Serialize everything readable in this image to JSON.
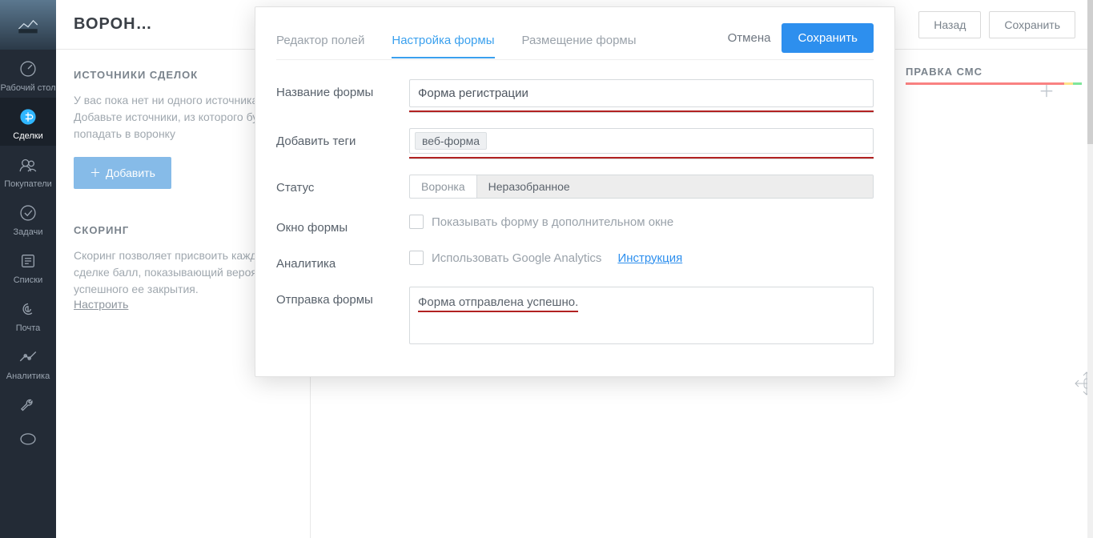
{
  "nav": {
    "items": [
      {
        "label": "Рабочий стол"
      },
      {
        "label": "Сделки"
      },
      {
        "label": "Покупатели"
      },
      {
        "label": "Задачи"
      },
      {
        "label": "Списки"
      },
      {
        "label": "Почта"
      },
      {
        "label": "Аналитика"
      }
    ]
  },
  "header": {
    "title": "ВОРОН…",
    "back": "Назад",
    "save": "Сохранить"
  },
  "sources": {
    "heading": "ИСТОЧНИКИ СДЕЛОК",
    "desc": "У вас пока нет ни одного источника. Добавьте источники, из которого будут попадать в воронку",
    "add": "Добавить"
  },
  "scoring": {
    "heading": "СКОРИНГ",
    "desc": "Скоринг позволяет присвоить каждой сделке балл, показывающий вероятность успешного ее закрытия.",
    "configure": "Настроить"
  },
  "stage": {
    "label": "ПРАВКА СМС"
  },
  "modal": {
    "tabs": {
      "editor": "Редактор полей",
      "settings": "Настройка формы",
      "placement": "Размещение формы"
    },
    "cancel": "Отмена",
    "save": "Сохранить",
    "form": {
      "name": {
        "label": "Название формы",
        "value": "Форма регистрации"
      },
      "tags": {
        "label": "Добавить теги",
        "tag": "веб-форма"
      },
      "status": {
        "label": "Статус",
        "pipeline": "Воронка",
        "stage": "Неразобранное"
      },
      "window": {
        "label": "Окно формы",
        "text": "Показывать форму в дополнительном окне"
      },
      "analytics": {
        "label": "Аналитика",
        "text": "Использовать Google Analytics",
        "instruction": "Инструкция"
      },
      "submit": {
        "label": "Отправка формы",
        "message": "Форма отправлена успешно."
      }
    }
  }
}
